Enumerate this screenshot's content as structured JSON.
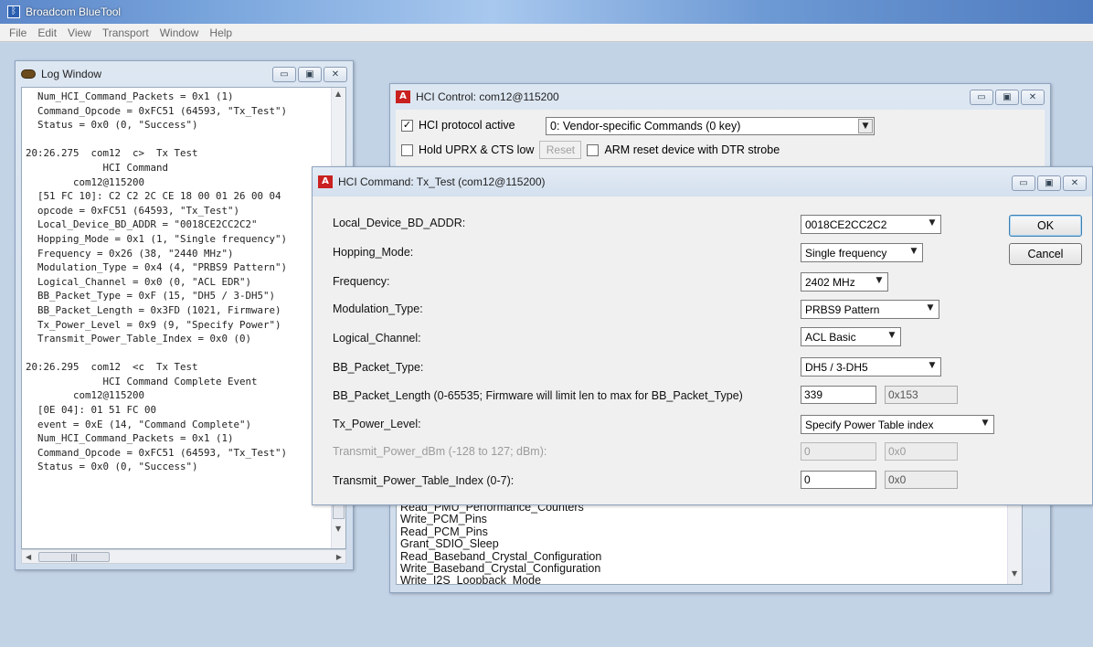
{
  "app": {
    "title": "Broadcom BlueTool",
    "icon": "bluetooth-icon"
  },
  "menu": [
    "File",
    "Edit",
    "View",
    "Transport",
    "Window",
    "Help"
  ],
  "log_window": {
    "title": "Log Window",
    "lines": [
      "  Num_HCI_Command_Packets = 0x1 (1)",
      "  Command_Opcode = 0xFC51 (64593, \"Tx_Test\")",
      "  Status = 0x0 (0, \"Success\")",
      "",
      "20:26.275  com12  c>  Tx Test",
      "             HCI Command",
      "        com12@115200",
      "  [51 FC 10]: C2 C2 2C CE 18 00 01 26 00 04",
      "  opcode = 0xFC51 (64593, \"Tx_Test\")",
      "  Local_Device_BD_ADDR = \"0018CE2CC2C2\"",
      "  Hopping_Mode = 0x1 (1, \"Single frequency\")",
      "  Frequency = 0x26 (38, \"2440 MHz\")",
      "  Modulation_Type = 0x4 (4, \"PRBS9 Pattern\")",
      "  Logical_Channel = 0x0 (0, \"ACL EDR\")",
      "  BB_Packet_Type = 0xF (15, \"DH5 / 3-DH5\")",
      "  BB_Packet_Length = 0x3FD (1021, Firmware)",
      "  Tx_Power_Level = 0x9 (9, \"Specify Power\")",
      "  Transmit_Power_Table_Index = 0x0 (0)",
      "",
      "20:26.295  com12  <c  Tx Test",
      "             HCI Command Complete Event",
      "        com12@115200",
      "  [0E 04]: 01 51 FC 00",
      "  event = 0xE (14, \"Command Complete\")",
      "  Num_HCI_Command_Packets = 0x1 (1)",
      "  Command_Opcode = 0xFC51 (64593, \"Tx_Test\")",
      "  Status = 0x0 (0, \"Success\")"
    ]
  },
  "hci_control": {
    "title": "HCI Control: com12@115200",
    "protocol_active_label": "HCI protocol active",
    "protocol_active_checked": true,
    "vendor_select": "0: Vendor-specific Commands (0 key)",
    "hold_label": "Hold UPRX & CTS low",
    "reset_label": "Reset",
    "arm_reset_label": "ARM reset device with DTR strobe",
    "list_items": [
      "Read_PMU_Performance_Counters",
      "Write_PCM_Pins",
      "Read_PCM_Pins",
      "Grant_SDIO_Sleep",
      "Read_Baseband_Crystal_Configuration",
      "Write_Baseband_Crystal_Configuration",
      "Write_I2S_Loopback_Mode"
    ]
  },
  "hci_command": {
    "title": "HCI Command: Tx_Test (com12@115200)",
    "ok_label": "OK",
    "cancel_label": "Cancel",
    "fields": {
      "bd_addr": {
        "label": "Local_Device_BD_ADDR:",
        "value": "0018CE2CC2C2"
      },
      "hopping_mode": {
        "label": "Hopping_Mode:",
        "value": "Single frequency"
      },
      "frequency": {
        "label": "Frequency:",
        "value": "2402 MHz"
      },
      "modulation_type": {
        "label": "Modulation_Type:",
        "value": "PRBS9 Pattern"
      },
      "logical_channel": {
        "label": "Logical_Channel:",
        "value": "ACL Basic"
      },
      "bb_packet_type": {
        "label": "BB_Packet_Type:",
        "value": "DH5 / 3-DH5"
      },
      "bb_packet_length": {
        "label": "BB_Packet_Length (0-65535; Firmware will limit len to max for BB_Packet_Type)",
        "value": "339",
        "hex": "0x153"
      },
      "tx_power_level": {
        "label": "Tx_Power_Level:",
        "value": "Specify Power Table index"
      },
      "transmit_power_dbm": {
        "label": "Transmit_Power_dBm (-128 to 127; dBm):",
        "value": "0",
        "hex": "0x0"
      },
      "transmit_power_table_index": {
        "label": "Transmit_Power_Table_Index (0-7):",
        "value": "0",
        "hex": "0x0"
      }
    }
  },
  "colors": {
    "titlebar_accent": "#5b86c9",
    "command_icon": "#c9211f"
  }
}
